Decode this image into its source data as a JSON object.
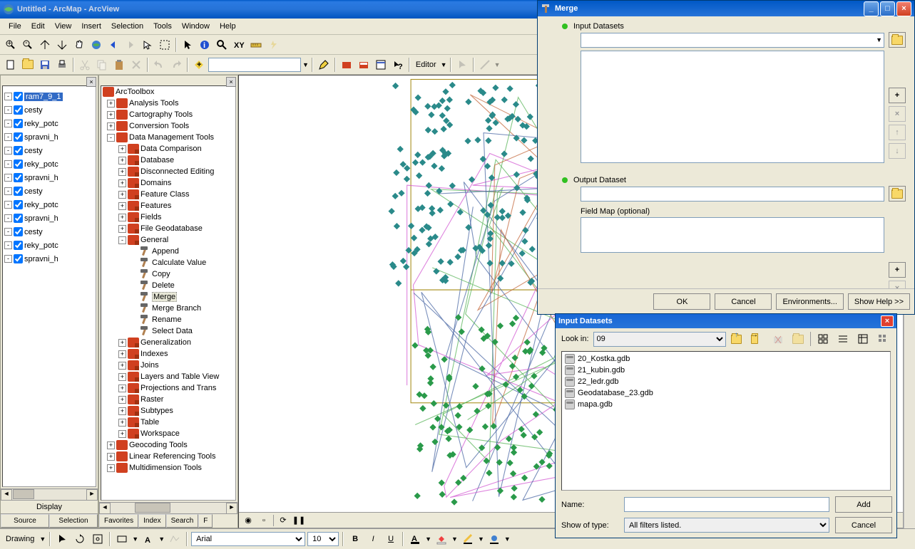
{
  "title": "Untitled - ArcMap - ArcView",
  "menu": [
    "File",
    "Edit",
    "View",
    "Insert",
    "Selection",
    "Tools",
    "Window",
    "Help"
  ],
  "editor_label": "Editor",
  "drawing_label": "Drawing",
  "font_name": "Arial",
  "font_size": "10",
  "toc": {
    "display": "Display",
    "tabs": [
      "Source",
      "Selection"
    ],
    "layers": [
      {
        "name": "ram7_9_1",
        "selected": true
      },
      {
        "name": "cesty"
      },
      {
        "name": "reky_potc"
      },
      {
        "name": "spravni_h"
      },
      {
        "name": "cesty"
      },
      {
        "name": "reky_potc"
      },
      {
        "name": "spravni_h"
      },
      {
        "name": "cesty"
      },
      {
        "name": "reky_potc"
      },
      {
        "name": "spravni_h"
      },
      {
        "name": "cesty"
      },
      {
        "name": "reky_potc"
      },
      {
        "name": "spravni_h"
      }
    ]
  },
  "toolbox": {
    "root": "ArcToolbox",
    "tabs": [
      "Favorites",
      "Index",
      "Search",
      "F"
    ],
    "tree": [
      {
        "l": 0,
        "t": "tb",
        "e": "+",
        "n": "Analysis Tools"
      },
      {
        "l": 0,
        "t": "tb",
        "e": "+",
        "n": "Cartography Tools"
      },
      {
        "l": 0,
        "t": "tb",
        "e": "+",
        "n": "Conversion Tools"
      },
      {
        "l": 0,
        "t": "tb",
        "e": "-",
        "n": "Data Management Tools"
      },
      {
        "l": 1,
        "t": "ts",
        "e": "+",
        "n": "Data Comparison"
      },
      {
        "l": 1,
        "t": "ts",
        "e": "+",
        "n": "Database"
      },
      {
        "l": 1,
        "t": "ts",
        "e": "+",
        "n": "Disconnected Editing"
      },
      {
        "l": 1,
        "t": "ts",
        "e": "+",
        "n": "Domains"
      },
      {
        "l": 1,
        "t": "ts",
        "e": "+",
        "n": "Feature Class"
      },
      {
        "l": 1,
        "t": "ts",
        "e": "+",
        "n": "Features"
      },
      {
        "l": 1,
        "t": "ts",
        "e": "+",
        "n": "Fields"
      },
      {
        "l": 1,
        "t": "ts",
        "e": "+",
        "n": "File Geodatabase"
      },
      {
        "l": 1,
        "t": "ts",
        "e": "-",
        "n": "General"
      },
      {
        "l": 2,
        "t": "tl",
        "n": "Append"
      },
      {
        "l": 2,
        "t": "tl",
        "n": "Calculate Value"
      },
      {
        "l": 2,
        "t": "tl",
        "n": "Copy"
      },
      {
        "l": 2,
        "t": "tl",
        "n": "Delete"
      },
      {
        "l": 2,
        "t": "tl",
        "n": "Merge",
        "sel": true
      },
      {
        "l": 2,
        "t": "tl",
        "n": "Merge Branch"
      },
      {
        "l": 2,
        "t": "tl",
        "n": "Rename"
      },
      {
        "l": 2,
        "t": "tl",
        "n": "Select Data"
      },
      {
        "l": 1,
        "t": "ts",
        "e": "+",
        "n": "Generalization"
      },
      {
        "l": 1,
        "t": "ts",
        "e": "+",
        "n": "Indexes"
      },
      {
        "l": 1,
        "t": "ts",
        "e": "+",
        "n": "Joins"
      },
      {
        "l": 1,
        "t": "ts",
        "e": "+",
        "n": "Layers and Table View"
      },
      {
        "l": 1,
        "t": "ts",
        "e": "+",
        "n": "Projections and Trans"
      },
      {
        "l": 1,
        "t": "ts",
        "e": "+",
        "n": "Raster"
      },
      {
        "l": 1,
        "t": "ts",
        "e": "+",
        "n": "Subtypes"
      },
      {
        "l": 1,
        "t": "ts",
        "e": "+",
        "n": "Table"
      },
      {
        "l": 1,
        "t": "ts",
        "e": "+",
        "n": "Workspace"
      },
      {
        "l": 0,
        "t": "tb",
        "e": "+",
        "n": "Geocoding Tools"
      },
      {
        "l": 0,
        "t": "tb",
        "e": "+",
        "n": "Linear Referencing Tools"
      },
      {
        "l": 0,
        "t": "tb",
        "e": "+",
        "n": "Multidimension Tools"
      }
    ]
  },
  "merge": {
    "title": "Merge",
    "input_label": "Input Datasets",
    "output_label": "Output Dataset",
    "fieldmap_label": "Field Map (optional)",
    "ok": "OK",
    "cancel": "Cancel",
    "env": "Environments...",
    "help": "Show Help >>"
  },
  "browse": {
    "title": "Input Datasets",
    "lookin_label": "Look in:",
    "lookin_value": "09",
    "name_label": "Name:",
    "name_value": "",
    "type_label": "Show of type:",
    "type_value": "All filters listed.",
    "add": "Add",
    "cancel": "Cancel",
    "items": [
      "20_Kostka.gdb",
      "21_kubin.gdb",
      "22_ledr.gdb",
      "Geodatabase_23.gdb",
      "mapa.gdb"
    ]
  }
}
